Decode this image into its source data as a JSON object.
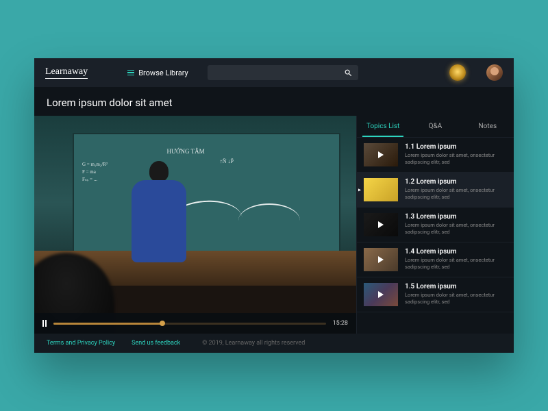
{
  "header": {
    "logo": "Learnaway",
    "browse_label": "Browse Library"
  },
  "page": {
    "title": "Lorem ipsum dolor sit amet"
  },
  "video": {
    "time": "15:28",
    "progress_percent": 40,
    "chalk_title": "HƯỚNG TÂM",
    "chalk_sub": "↑N̄\n↓P̄"
  },
  "sidebar": {
    "tabs": [
      {
        "label": "Topics List",
        "active": true
      },
      {
        "label": "Q&A",
        "active": false
      },
      {
        "label": "Notes",
        "active": false
      }
    ],
    "topics": [
      {
        "title": "1.1 Lorem ipsum",
        "desc": "Lorem ipsum dolor sit amet, onsectetur sadipscing elitr, sed",
        "selected": false
      },
      {
        "title": "1.2 Lorem ipsum",
        "desc": "Lorem ipsum dolor sit amet, onsectetur sadipscing elitr, sed",
        "selected": true
      },
      {
        "title": "1.3 Lorem ipsum",
        "desc": "Lorem ipsum dolor sit amet, onsectetur sadipscing elitr, sed",
        "selected": false
      },
      {
        "title": "1.4 Lorem ipsum",
        "desc": "Lorem ipsum dolor sit amet, onsectetur sadipscing elitr, sed",
        "selected": false
      },
      {
        "title": "1.5 Lorem ipsum",
        "desc": "Lorem ipsum dolor sit amet, onsectetur sadipscing elitr, sed",
        "selected": false
      }
    ]
  },
  "footer": {
    "terms": "Terms and Privacy Policy",
    "feedback": "Send us feedback",
    "copyright": "© 2019,  Learnaway all rights reserved"
  }
}
